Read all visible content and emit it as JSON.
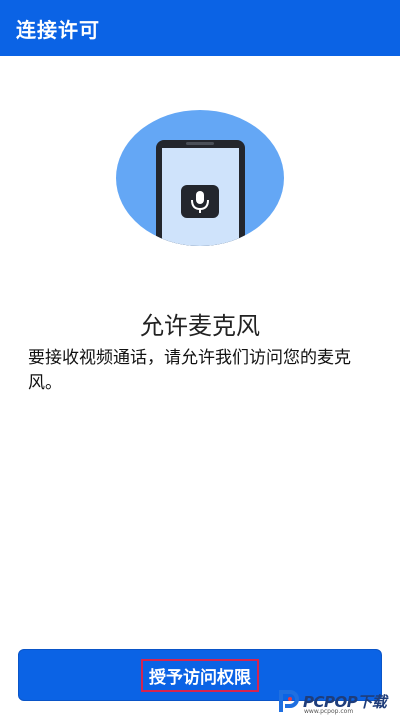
{
  "appbar": {
    "title": "连接许可"
  },
  "illustration": {
    "icon": "microphone-icon",
    "circle_color": "#64a7f5",
    "phone_color": "#23262d",
    "screen_color": "#cfe3fb"
  },
  "permission": {
    "title": "允许麦克风",
    "description": "要接收视频通话，请允许我们访问您的麦克风。"
  },
  "grant_button": {
    "label": "授予访问权限"
  },
  "watermark": {
    "text": "PCPOP下载",
    "sub": "www.pcpop.com"
  },
  "colors": {
    "primary": "#0b63e5",
    "highlight_border": "#d6244f"
  }
}
